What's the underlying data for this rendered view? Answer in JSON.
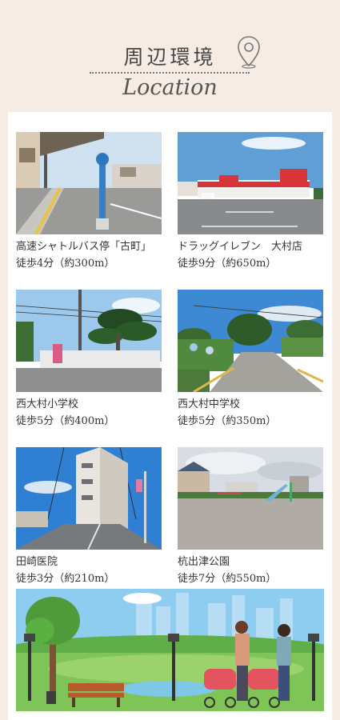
{
  "header": {
    "title": "周辺環境",
    "subtitle": "Location",
    "icon": "location-pin-icon"
  },
  "places": [
    {
      "name": "高速シャトルバス停「古町」",
      "distance": "徒歩4分（約300m）",
      "photo": "bus-stop-photo"
    },
    {
      "name": "ドラッグイレブン　大村店",
      "distance": "徒歩9分（約650m）",
      "photo": "drugstore-photo"
    },
    {
      "name": "西大村小学校",
      "distance": "徒歩5分（約400m）",
      "photo": "elementary-school-photo"
    },
    {
      "name": "西大村中学校",
      "distance": "徒歩5分（約350m）",
      "photo": "junior-high-school-photo"
    },
    {
      "name": "田崎医院",
      "distance": "徒歩3分（約210m）",
      "photo": "clinic-photo"
    },
    {
      "name": "杭出津公園",
      "distance": "徒歩7分（約550m）",
      "photo": "park-photo"
    }
  ],
  "illustration": "park-family-illustration",
  "colors": {
    "background": "#f7ece4",
    "panel": "#ffffff",
    "text": "#333333"
  }
}
